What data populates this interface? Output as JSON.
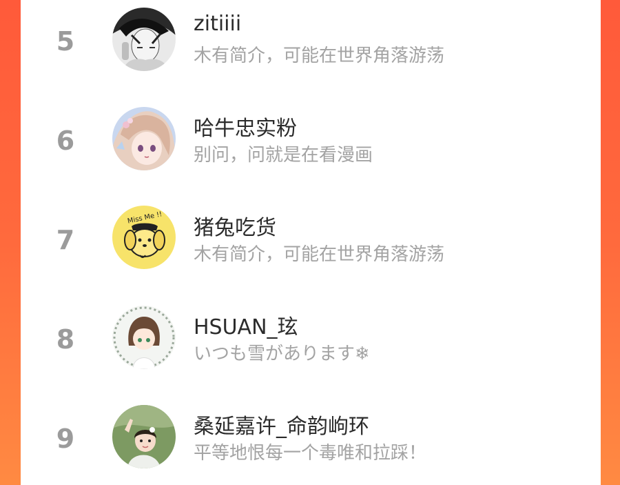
{
  "ranking": {
    "items": [
      {
        "rank": "5",
        "name": "zitiiii",
        "bio": "木有简介，可能在世界角落游荡",
        "avatar_icon": "manga-boy-avatar-icon"
      },
      {
        "rank": "6",
        "name": "哈牛忠实粉",
        "bio": "别问，问就是在看漫画",
        "avatar_icon": "anime-girl-avatar-icon"
      },
      {
        "rank": "7",
        "name": "猪兔吃货",
        "bio": "木有简介，可能在世界角落游荡",
        "avatar_icon": "yellow-dog-avatar-icon",
        "avatar_text": "Miss Me !!"
      },
      {
        "rank": "8",
        "name": "HSUAN_玹",
        "bio": "いつも雪があります❄",
        "avatar_icon": "chibi-girl-avatar-icon"
      },
      {
        "rank": "9",
        "name": "桑延嘉许_命韵岣环",
        "bio": "平等地恨每一个毒唯和拉踩！",
        "avatar_icon": "child-photo-avatar-icon"
      }
    ]
  },
  "colors": {
    "accent_left": "#ff5a3a",
    "accent_right": "#ff8a42",
    "rank_gray": "#9b9b9b",
    "name_dark": "#2b2b2b",
    "bio_gray": "#a3a3a3"
  }
}
